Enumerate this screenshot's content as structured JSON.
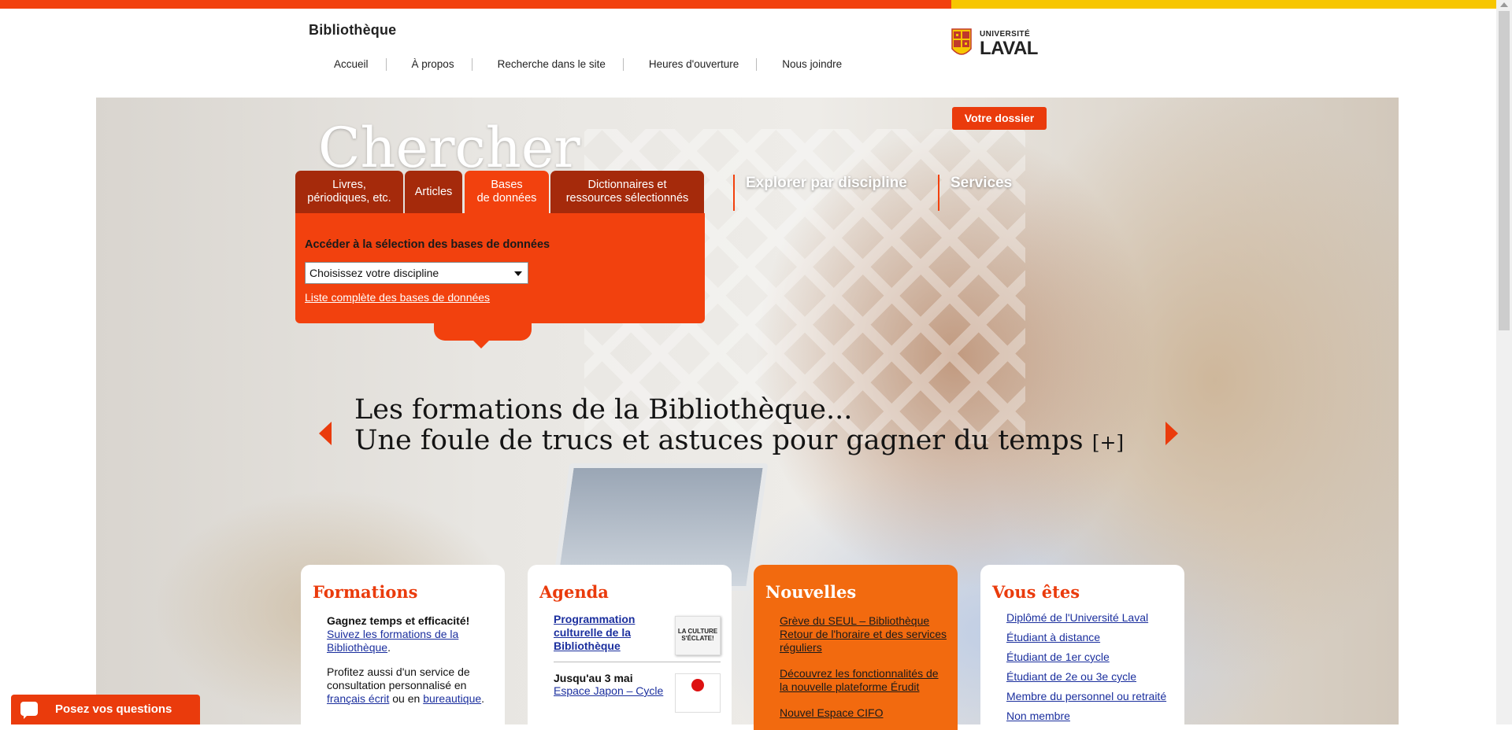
{
  "header": {
    "site_title": "Bibliothèque",
    "nav": [
      "Accueil",
      "À propos",
      "Recherche dans le site",
      "Heures d'ouverture",
      "Nous joindre"
    ],
    "logo": {
      "line1": "UNIVERSITÉ",
      "line2": "LAVAL"
    }
  },
  "hero": {
    "dossier_button": "Votre dossier",
    "search_heading": "Chercher",
    "tabs": [
      {
        "line1": "Livres,",
        "line2": "périodiques, etc."
      },
      {
        "line1": "Articles",
        "line2": ""
      },
      {
        "line1": "Bases",
        "line2": "de données"
      },
      {
        "line1": "Dictionnaires et",
        "line2": "ressources sélectionnés"
      }
    ],
    "panel_label": "Accéder à la sélection des bases de données",
    "select_value": "Choisissez votre discipline",
    "db_list_link": "Liste complète des bases de données",
    "explore_link": "Explorer par discipline",
    "services_link": "Services",
    "slide_line1": "Les formations de la Bibliothèque...",
    "slide_line2": "Une foule de trucs et astuces pour gagner du temps",
    "slide_more": "[+]"
  },
  "cards": {
    "formations": {
      "title": "Formations",
      "p1_bold": "Gagnez temps et efficacité!",
      "p1_link": "Suivez les formations de la Bibliothèque",
      "p1_end": ".",
      "p2_text": "Profitez aussi d'un service de consultation personnalisé en ",
      "p2_link1": "français écrit",
      "p2_mid": " ou en ",
      "p2_link2": "bureautique",
      "p2_end": "."
    },
    "agenda": {
      "title": "Agenda",
      "item1_title": "Programmation culturelle de la Bibliothèque",
      "item1_thumb": "LA CULTURE S'ÉCLATE!",
      "item2_date": "Jusqu'au 3 mai",
      "item2_title": "Espace Japon – Cycle"
    },
    "nouvelles": {
      "title": "Nouvelles",
      "items": [
        "Grève du SEUL – Bibliothèque Retour de l'horaire et des services réguliers",
        "Découvrez les fonctionnalités de la nouvelle plateforme Érudit",
        "Nouvel Espace CIFO"
      ]
    },
    "vous": {
      "title": "Vous êtes",
      "items": [
        "Diplômé de l'Université Laval",
        "Étudiant à distance",
        "Étudiant de 1er cycle",
        "Étudiant de 2e ou 3e cycle",
        "Membre du personnel ou retraité",
        "Non membre"
      ]
    }
  },
  "chat": {
    "label": "Posez vos questions"
  },
  "colors": {
    "brand_orange": "#f2410e",
    "brand_yellow": "#f7c600",
    "news_orange": "#f26a0f",
    "link_blue": "#1b2f9e"
  }
}
